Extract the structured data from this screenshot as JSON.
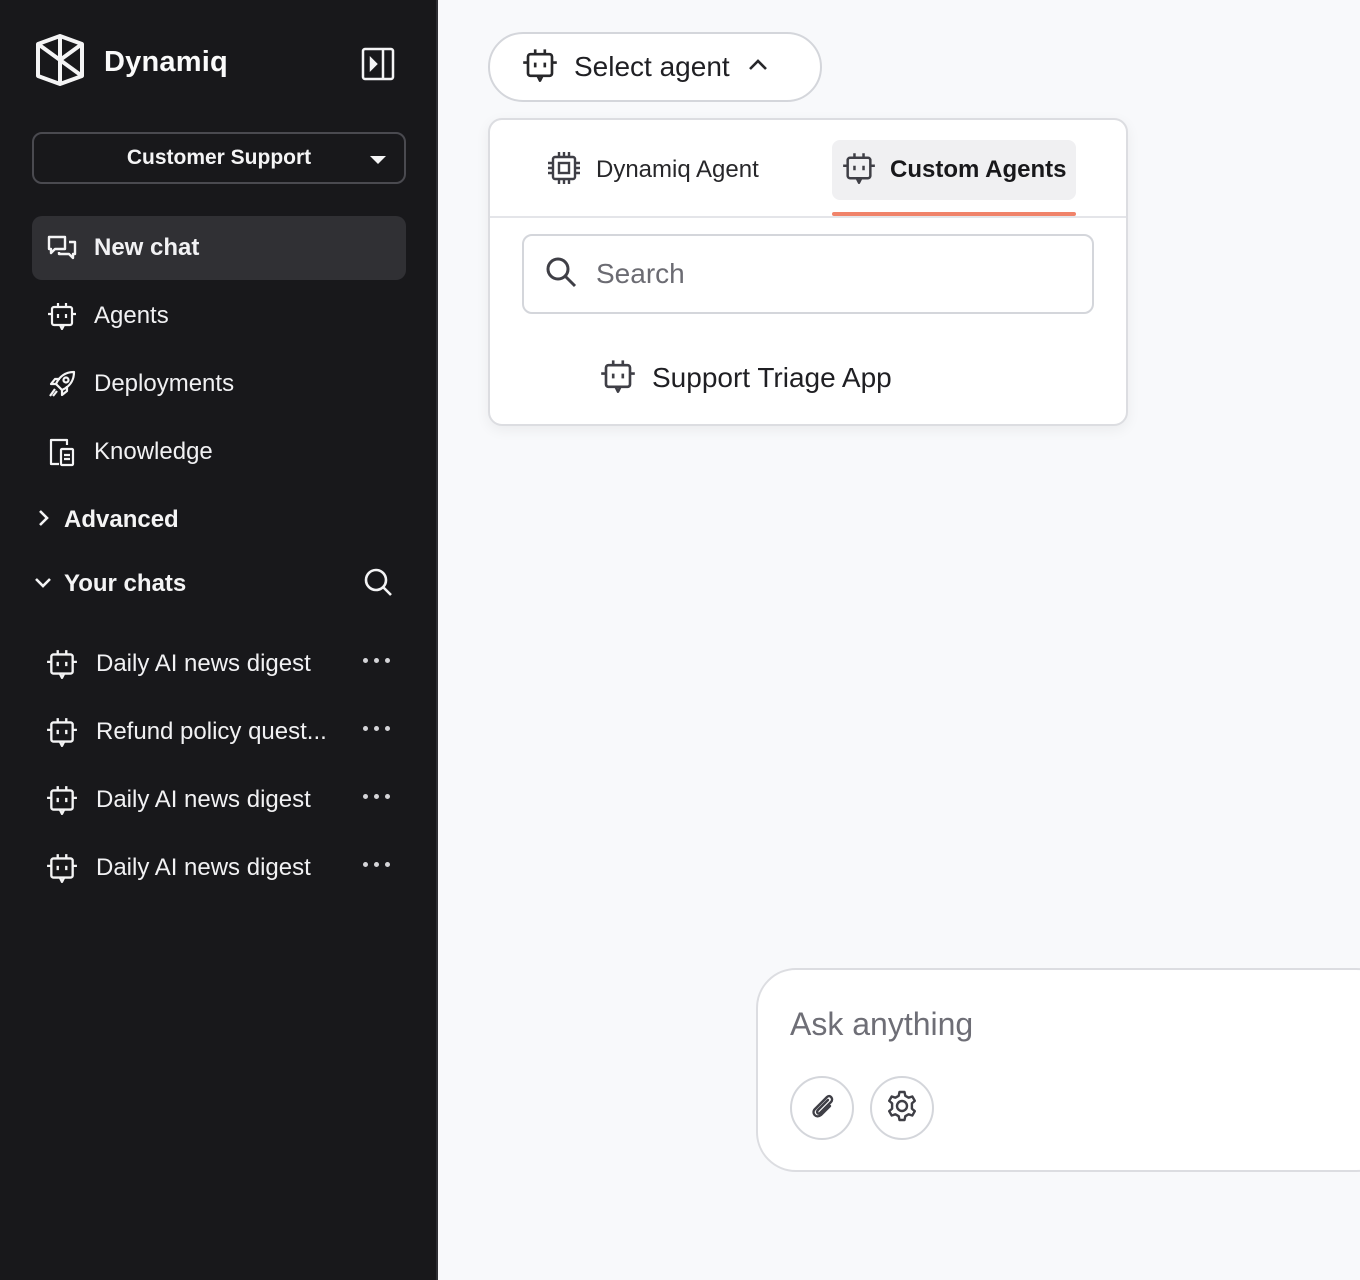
{
  "app": {
    "name": "Dynamiq"
  },
  "sidebar": {
    "workspace": "Customer Support",
    "nav": [
      {
        "label": "New chat",
        "icon": "chat-bubbles-icon"
      },
      {
        "label": "Agents",
        "icon": "bot-icon"
      },
      {
        "label": "Deployments",
        "icon": "rocket-icon"
      },
      {
        "label": "Knowledge",
        "icon": "knowledge-icon"
      }
    ],
    "advanced_label": "Advanced",
    "chats_label": "Your chats",
    "chats": [
      {
        "title": "Daily AI news digest"
      },
      {
        "title": "Refund policy quest..."
      },
      {
        "title": "Daily AI news digest"
      },
      {
        "title": "Daily AI news digest"
      }
    ]
  },
  "agent_selector": {
    "label": "Select agent",
    "tabs": [
      {
        "label": "Dynamiq Agent",
        "icon": "chip-icon"
      },
      {
        "label": "Custom Agents",
        "icon": "bot-icon"
      }
    ],
    "active_tab": "Custom Agents",
    "search_placeholder": "Search",
    "options": [
      {
        "label": "Support Triage App"
      }
    ]
  },
  "composer": {
    "placeholder": "Ask anything"
  },
  "colors": {
    "sidebar_bg": "#18181b",
    "accent": "#f0836a",
    "main_bg": "#f8f9fb"
  }
}
